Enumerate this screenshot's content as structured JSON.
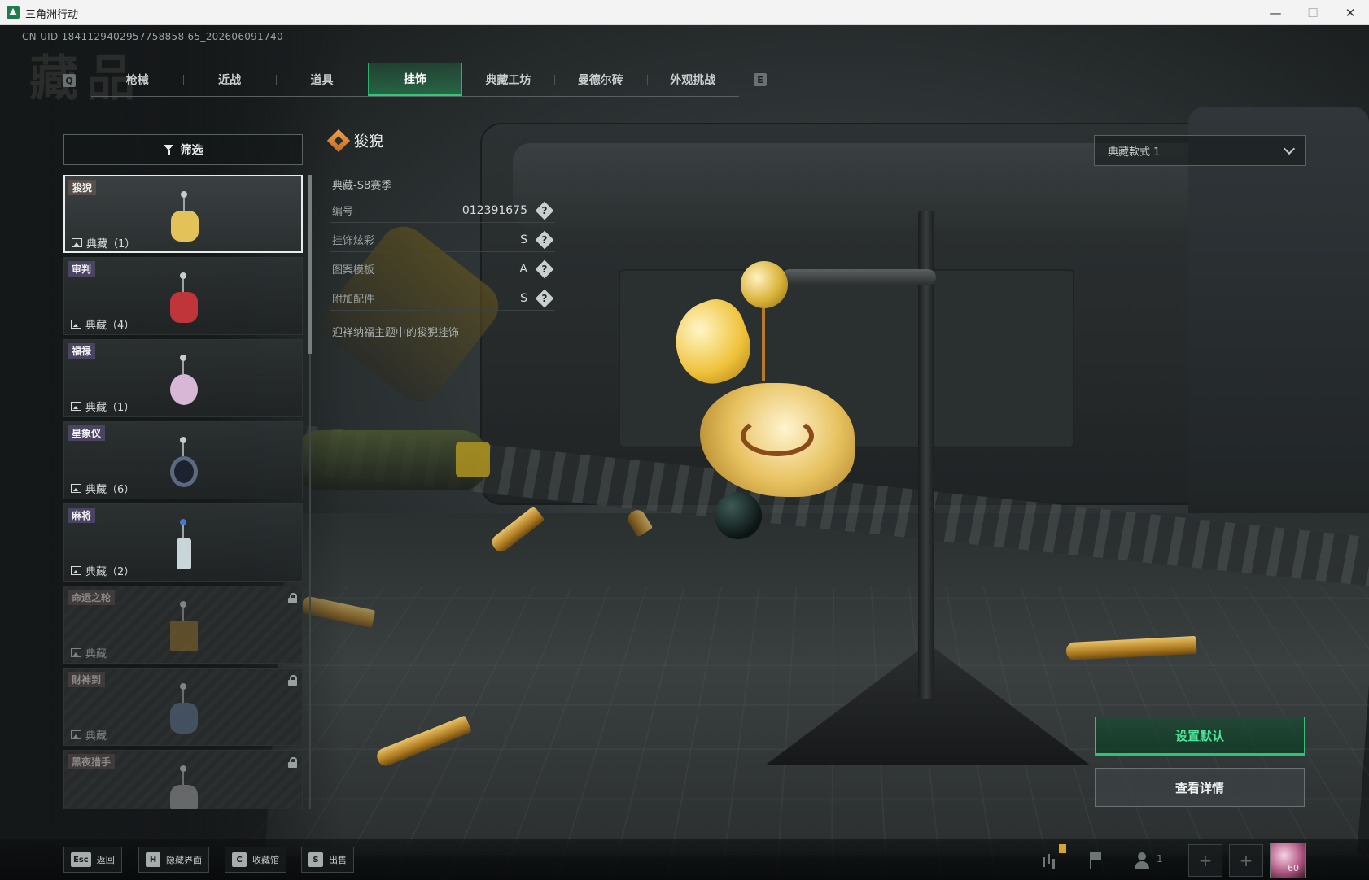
{
  "window": {
    "title": "三角洲行动",
    "controls": {
      "minimize": "—",
      "maximize": "☐",
      "close": "✕"
    }
  },
  "uid": "CN UID 1841129402957758858 65_202606091740",
  "background_title": "藏品",
  "hotkeys": {
    "prev_tab": "Q",
    "next_tab": "E"
  },
  "tabs": [
    {
      "label": "枪械",
      "active": false
    },
    {
      "label": "近战",
      "active": false
    },
    {
      "label": "道具",
      "active": false
    },
    {
      "label": "挂饰",
      "active": true
    },
    {
      "label": "典藏工坊",
      "active": false
    },
    {
      "label": "曼德尔砖",
      "active": false
    },
    {
      "label": "外观挑战",
      "active": false
    }
  ],
  "filter": {
    "label": "筛选"
  },
  "items": [
    {
      "name": "狻猊",
      "count": "典藏（1）",
      "selected": true,
      "locked": false,
      "color": "#e3c25a"
    },
    {
      "name": "审判",
      "count": "典藏（4）",
      "selected": false,
      "locked": false,
      "color": "#c0353a"
    },
    {
      "name": "福禄",
      "count": "典藏（1）",
      "selected": false,
      "locked": false,
      "color": "#d8b6d6"
    },
    {
      "name": "星象仪",
      "count": "典藏（6）",
      "selected": false,
      "locked": false,
      "color": "#5a6a82"
    },
    {
      "name": "麻将",
      "count": "典藏（2）",
      "selected": false,
      "locked": false,
      "color": "#c9d6d9"
    },
    {
      "name": "命运之轮",
      "count": "典藏",
      "selected": false,
      "locked": true,
      "color": "#8a6b2a"
    },
    {
      "name": "财神到",
      "count": "典藏",
      "selected": false,
      "locked": true,
      "color": "#5a6f8a"
    },
    {
      "name": "黑夜猎手",
      "count": "",
      "selected": false,
      "locked": true,
      "color": "#9a9a9a"
    }
  ],
  "detail": {
    "name": "狻猊",
    "season": "典藏-S8赛季",
    "attributes": [
      {
        "label": "编号",
        "value": "012391675"
      },
      {
        "label": "挂饰炫彩",
        "value": "S"
      },
      {
        "label": "图案模板",
        "value": "A"
      },
      {
        "label": "附加配件",
        "value": "S"
      }
    ],
    "help_glyph": "?",
    "description": "迎祥纳福主题中的狻猊挂饰"
  },
  "style_select": {
    "value": "典藏款式 1"
  },
  "actions": {
    "set_default": "设置默认",
    "view_details": "查看详情"
  },
  "bottom_hints": [
    {
      "key": "Esc",
      "label": "返回"
    },
    {
      "key": "H",
      "label": "隐藏界面"
    },
    {
      "key": "C",
      "label": "收藏馆"
    },
    {
      "key": "S",
      "label": "出售"
    }
  ],
  "hud": {
    "team_count": "1",
    "slot_add": "+",
    "avatar_level": "60"
  },
  "accent_colors": {
    "active": "#2fc277",
    "tag": "#4a4361"
  }
}
